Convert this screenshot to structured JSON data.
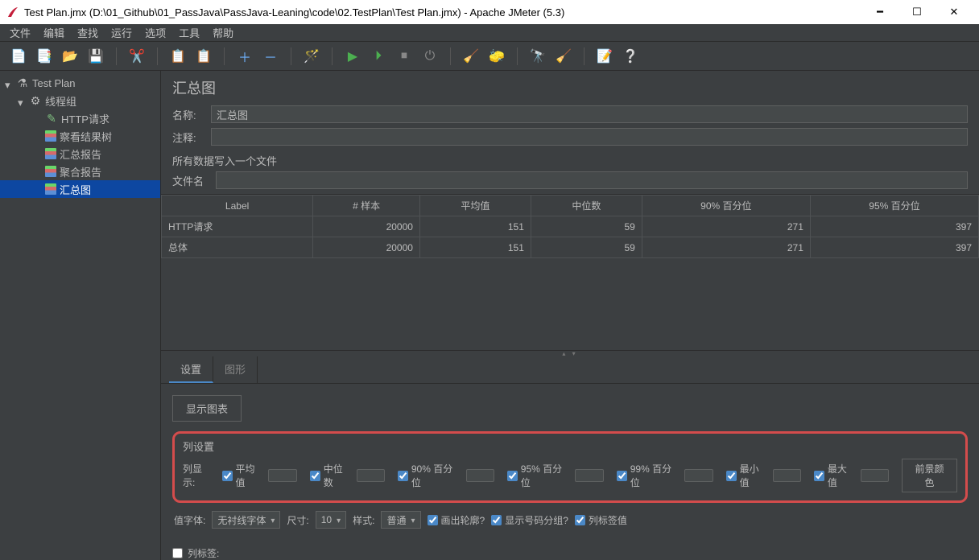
{
  "window": {
    "title": "Test Plan.jmx (D:\\01_Github\\01_PassJava\\PassJava-Leaning\\code\\02.TestPlan\\Test Plan.jmx) - Apache JMeter (5.3)"
  },
  "menu": {
    "file": "文件",
    "edit": "编辑",
    "search": "查找",
    "run": "运行",
    "options": "选项",
    "tools": "工具",
    "help": "帮助"
  },
  "tree": {
    "root": "Test Plan",
    "group": "线程组",
    "http": "HTTP请求",
    "result_tree": "察看结果树",
    "summary_report": "汇总报告",
    "aggregate_report": "聚合报告",
    "aggregate_graph": "汇总图"
  },
  "panel": {
    "heading": "汇总图",
    "name_label": "名称:",
    "name_value": "汇总图",
    "comment_label": "注释:",
    "comment_value": "",
    "write_all": "所有数据写入一个文件",
    "file_label": "文件名",
    "file_value": ""
  },
  "table": {
    "headers": [
      "Label",
      "# 样本",
      "平均值",
      "中位数",
      "90% 百分位",
      "95% 百分位"
    ],
    "rows": [
      {
        "label": "HTTP请求",
        "samples": "20000",
        "avg": "151",
        "median": "59",
        "p90": "271",
        "p95": "397"
      },
      {
        "label": "总体",
        "samples": "20000",
        "avg": "151",
        "median": "59",
        "p90": "271",
        "p95": "397"
      }
    ]
  },
  "tabs": {
    "settings": "设置",
    "graph": "图形"
  },
  "settings": {
    "show_graph": "显示图表",
    "col_box_label": "列设置",
    "col_show_label": "列显示:",
    "avg": "平均值",
    "median": "中位数",
    "p90": "90% 百分位",
    "p95": "95% 百分位",
    "p99": "99% 百分位",
    "min": "最小值",
    "max": "最大值",
    "fg_color": "前景颜色",
    "font_label": "值字体:",
    "font_family": "无衬线字体",
    "size_label": "尺寸:",
    "size_value": "10",
    "style_label": "样式:",
    "style_value": "普通",
    "outline": "画出轮廓?",
    "group_num": "显示号码分组?",
    "col_tag": "列标签值",
    "trail_chk": "列标签:"
  }
}
